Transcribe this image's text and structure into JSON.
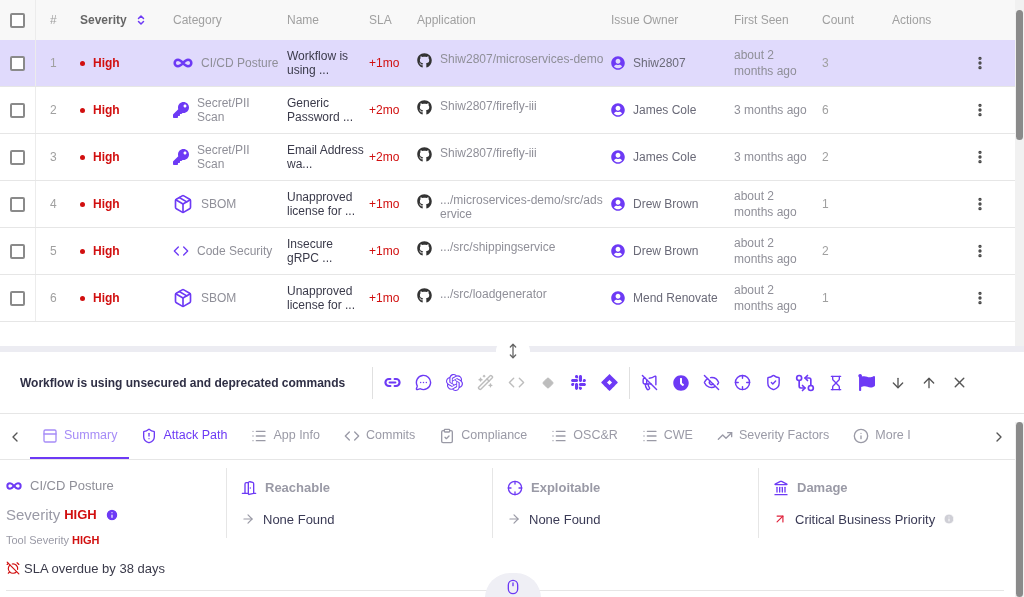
{
  "table": {
    "columns": [
      {
        "label": "#",
        "sortable": false
      },
      {
        "label": "Severity",
        "sortable": true
      },
      {
        "label": "Category",
        "sortable": false
      },
      {
        "label": "Name",
        "sortable": false
      },
      {
        "label": "SLA",
        "sortable": false
      },
      {
        "label": "Application",
        "sortable": false
      },
      {
        "label": "Issue Owner",
        "sortable": false
      },
      {
        "label": "First Seen",
        "sortable": false
      },
      {
        "label": "Count",
        "sortable": false
      },
      {
        "label": "Actions",
        "sortable": false
      }
    ],
    "header_checked": false,
    "rows": [
      {
        "selected": true,
        "checked": false,
        "index": "1",
        "severity": "High",
        "category": {
          "kind": "cicd",
          "label": "CI/CD Posture"
        },
        "name": "Workflow is using ...",
        "sla": "+1mo",
        "application": "Shiw2807/microservices-demo",
        "owner": "Shiw2807",
        "first_seen": "about 2 months ago",
        "count": "3"
      },
      {
        "selected": false,
        "checked": false,
        "index": "2",
        "severity": "High",
        "category": {
          "kind": "secret",
          "label": "Secret/PII Scan"
        },
        "name": "Generic Password ...",
        "sla": "+2mo",
        "application": "Shiw2807/firefly-iii",
        "owner": "James Cole",
        "first_seen": "3 months ago",
        "count": "6"
      },
      {
        "selected": false,
        "checked": false,
        "index": "3",
        "severity": "High",
        "category": {
          "kind": "secret",
          "label": "Secret/PII Scan"
        },
        "name": "Email Address wa...",
        "sla": "+2mo",
        "application": "Shiw2807/firefly-iii",
        "owner": "James Cole",
        "first_seen": "3 months ago",
        "count": "2"
      },
      {
        "selected": false,
        "checked": false,
        "index": "4",
        "severity": "High",
        "category": {
          "kind": "sbom",
          "label": "SBOM"
        },
        "name": "Unapproved license for ...",
        "sla": "+1mo",
        "application": ".../microservices-demo/src/adservice",
        "owner": "Drew Brown",
        "first_seen": "about 2 months ago",
        "count": "1"
      },
      {
        "selected": false,
        "checked": false,
        "index": "5",
        "severity": "High",
        "category": {
          "kind": "code",
          "label": "Code Security"
        },
        "name": "Insecure gRPC ...",
        "sla": "+1mo",
        "application": ".../src/shippingservice",
        "owner": "Drew Brown",
        "first_seen": "about 2 months ago",
        "count": "2"
      },
      {
        "selected": false,
        "checked": false,
        "index": "6",
        "severity": "High",
        "category": {
          "kind": "sbom",
          "label": "SBOM"
        },
        "name": "Unapproved license for ...",
        "sla": "+1mo",
        "application": ".../src/loadgenerator",
        "owner": "Mend Renovate",
        "first_seen": "about 2 months ago",
        "count": "1"
      }
    ]
  },
  "detail": {
    "title": "Workflow is using unsecured and deprecated commands",
    "tools": [
      {
        "kind": "link",
        "disabled": false
      },
      {
        "kind": "comment",
        "disabled": false
      },
      {
        "kind": "ai",
        "disabled": false
      },
      {
        "kind": "wand",
        "disabled": true
      },
      {
        "kind": "code",
        "disabled": true
      },
      {
        "kind": "git",
        "disabled": true
      },
      {
        "kind": "slack",
        "disabled": false
      },
      {
        "kind": "jira",
        "disabled": false
      },
      {
        "kind": "divider"
      },
      {
        "kind": "mute",
        "disabled": false
      },
      {
        "kind": "clock",
        "disabled": false
      },
      {
        "kind": "hide",
        "disabled": false
      },
      {
        "kind": "target",
        "disabled": false
      },
      {
        "kind": "shield",
        "disabled": false
      },
      {
        "kind": "flow",
        "disabled": false
      },
      {
        "kind": "hourglass",
        "disabled": false
      },
      {
        "kind": "flag",
        "disabled": false
      },
      {
        "kind": "down",
        "disabled": false
      },
      {
        "kind": "up",
        "disabled": false
      },
      {
        "kind": "close",
        "disabled": false
      }
    ],
    "tabs": [
      {
        "label": "Summary",
        "kind": "summary",
        "selected": true,
        "highlighted": false
      },
      {
        "label": "Attack Path",
        "kind": "attack",
        "selected": false,
        "highlighted": true
      },
      {
        "label": "App Info",
        "kind": "app",
        "selected": false,
        "highlighted": false
      },
      {
        "label": "Commits",
        "kind": "commits",
        "selected": false,
        "highlighted": false
      },
      {
        "label": "Compliance",
        "kind": "compliance",
        "selected": false,
        "highlighted": false
      },
      {
        "label": "OSC&R",
        "kind": "list",
        "selected": false,
        "highlighted": false
      },
      {
        "label": "CWE",
        "kind": "list",
        "selected": false,
        "highlighted": false
      },
      {
        "label": "Severity Factors",
        "kind": "factors",
        "selected": false,
        "highlighted": false
      },
      {
        "label": "More I",
        "kind": "info",
        "selected": false,
        "highlighted": false
      }
    ],
    "summary": {
      "category": "CI/CD Posture",
      "severity_label": "Severity",
      "severity": "HIGH",
      "tool_severity_label": "Tool Severity",
      "tool_severity": "HIGH",
      "sla": "SLA overdue by 38 days"
    },
    "factors": [
      {
        "kind": "reachable",
        "title": "Reachable",
        "value": {
          "kind": "neutral",
          "text": "None Found"
        },
        "info": false
      },
      {
        "kind": "exploitable",
        "title": "Exploitable",
        "value": {
          "kind": "neutral",
          "text": "None Found"
        },
        "info": false
      },
      {
        "kind": "damage",
        "title": "Damage",
        "value": {
          "kind": "rising",
          "text": "Critical Business Priority"
        },
        "info": true
      }
    ]
  }
}
